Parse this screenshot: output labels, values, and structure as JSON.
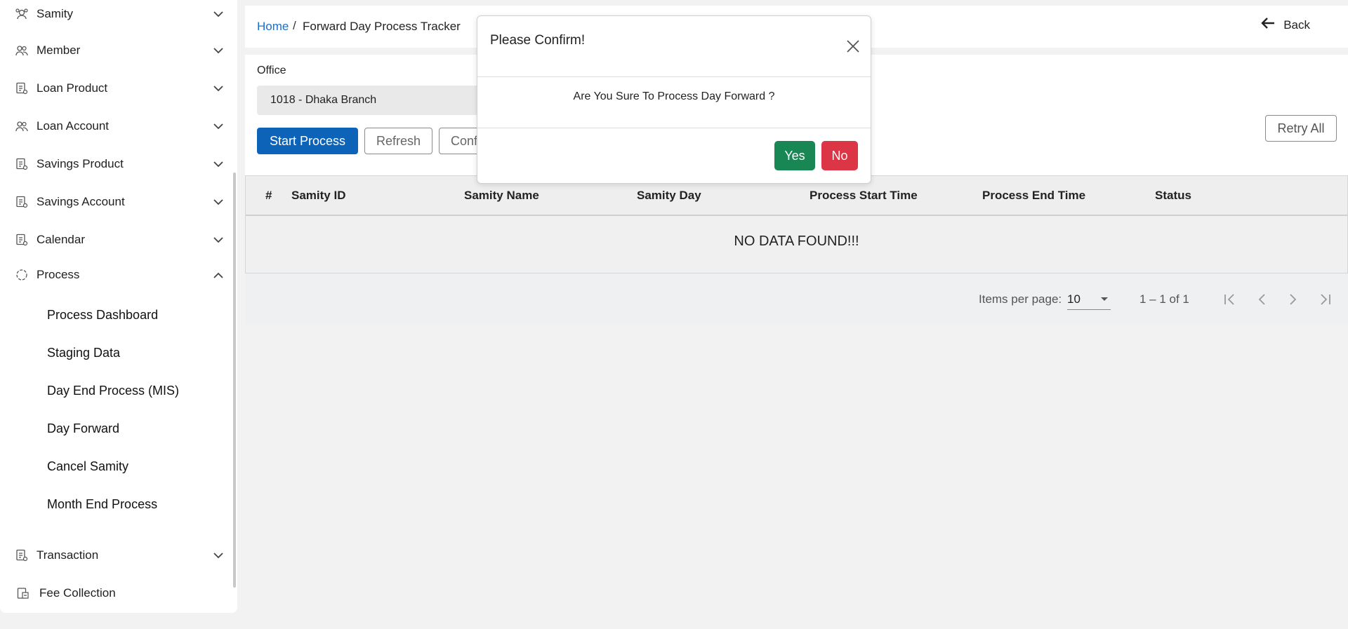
{
  "sidebar": {
    "items": [
      {
        "label": "Samity",
        "icon": "network-icon"
      },
      {
        "label": "Member",
        "icon": "users-icon"
      },
      {
        "label": "Loan Product",
        "icon": "document-icon"
      },
      {
        "label": "Loan Account",
        "icon": "users-icon"
      },
      {
        "label": "Savings Product",
        "icon": "document-icon"
      },
      {
        "label": "Savings Account",
        "icon": "document-icon"
      },
      {
        "label": "Calendar",
        "icon": "document-icon"
      },
      {
        "label": "Process",
        "icon": "refresh-circle-icon",
        "expanded": true
      },
      {
        "label": "Transaction",
        "icon": "document-icon"
      },
      {
        "label": "Fee Collection",
        "icon": "fee-icon"
      }
    ],
    "process_subitems": [
      "Process Dashboard",
      "Staging Data",
      "Day End Process (MIS)",
      "Day Forward",
      "Cancel Samity",
      "Month End Process"
    ]
  },
  "header": {
    "home": "Home",
    "separator": "/",
    "title": "Forward Day Process Tracker",
    "back": "Back"
  },
  "form": {
    "office_label": "Office",
    "office_value": "1018 - Dhaka Branch"
  },
  "toolbar": {
    "start_process": "Start Process",
    "refresh": "Refresh",
    "conf": "Conf",
    "retry_all": "Retry All"
  },
  "table": {
    "columns": [
      "#",
      "Samity ID",
      "Samity Name",
      "Samity Day",
      "Process Start Time",
      "Process End Time",
      "Status"
    ],
    "empty_message": "NO DATA FOUND!!!"
  },
  "paginator": {
    "items_per_page_label": "Items per page:",
    "items_per_page_value": "10",
    "range": "1 – 1 of 1"
  },
  "modal": {
    "title": "Please Confirm!",
    "message": "Are You Sure To Process Day Forward ?",
    "yes": "Yes",
    "no": "No"
  },
  "colors": {
    "primary": "#0d63b8",
    "link": "#1a6fd1",
    "yes": "#198754",
    "no": "#dc3545"
  }
}
